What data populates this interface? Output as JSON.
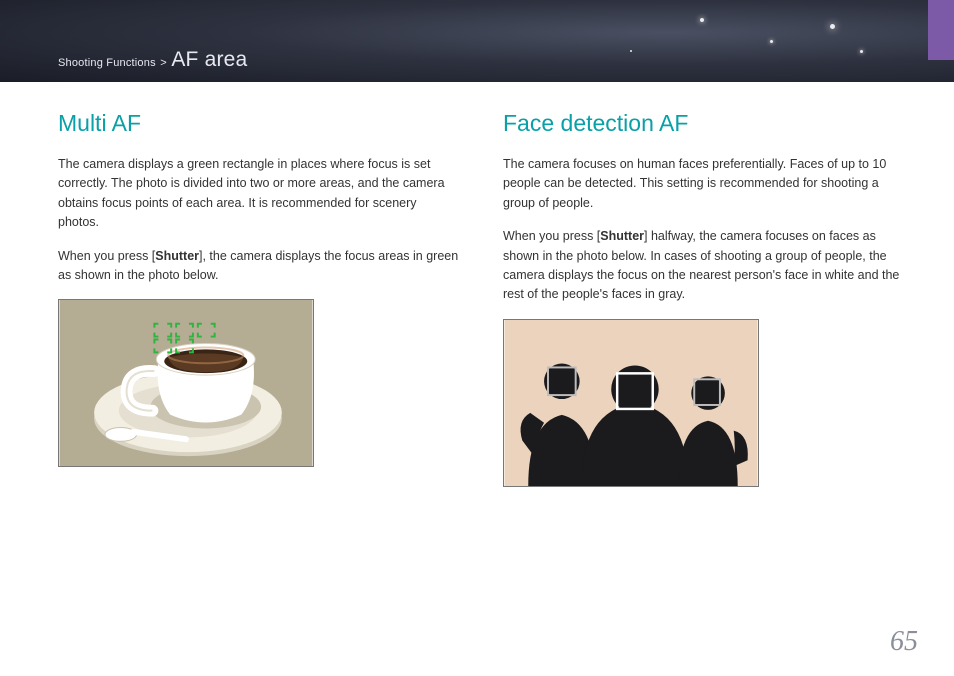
{
  "breadcrumb": {
    "section": "Shooting Functions",
    "sep": ">",
    "title": "AF area"
  },
  "left": {
    "heading": "Multi AF",
    "p1": "The camera displays a green rectangle in places where focus is set correctly. The photo is divided into two or more areas, and the camera obtains focus points of each area. It is recommended for scenery photos.",
    "p2_a": "When you press [",
    "p2_b": "Shutter",
    "p2_c": "], the camera displays the focus areas in green as shown in the photo below."
  },
  "right": {
    "heading": "Face detection AF",
    "p1": "The camera focuses on human faces preferentially. Faces of up to 10 people can be detected. This setting is recommended for shooting a group of people.",
    "p2_a": "When you press [",
    "p2_b": "Shutter",
    "p2_c": "] halfway, the camera focuses on faces as shown in the photo below. In cases of shooting a group of people, the camera displays the focus on the nearest person's face in white and the rest of the people's faces in gray."
  },
  "page_number": "65",
  "icons": {
    "focus_box_color": "#2fb43f"
  }
}
